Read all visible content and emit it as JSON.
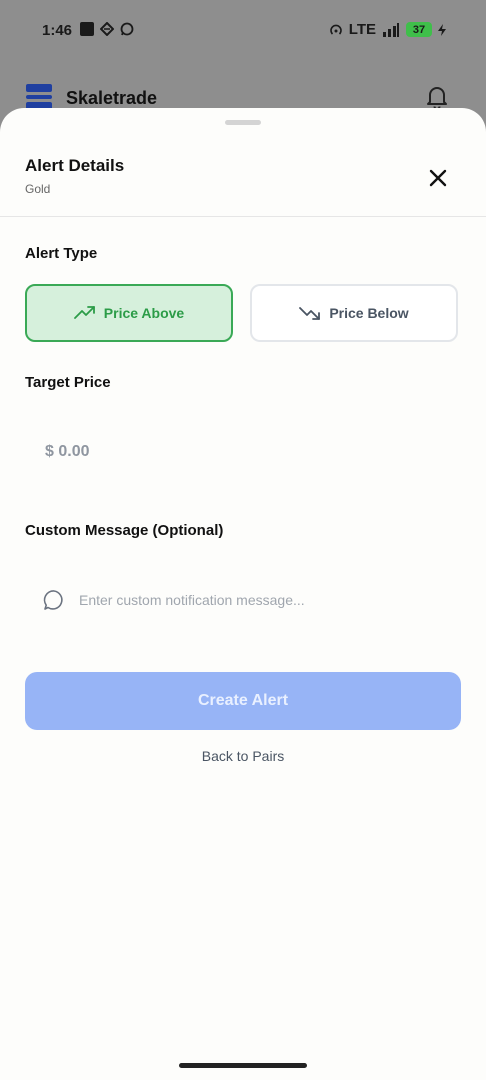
{
  "status_bar": {
    "time": "1:46",
    "network": "LTE",
    "battery": "37"
  },
  "app": {
    "brand": "Skaletrade",
    "brand_color": "#1f3fa0"
  },
  "sheet": {
    "title": "Alert Details",
    "subtitle": "Gold",
    "alert_type_label": "Alert Type",
    "price_above_label": "Price Above",
    "price_below_label": "Price Below",
    "selected_type": "price_above",
    "target_price_label": "Target Price",
    "target_price_placeholder": "$ 0.00",
    "custom_message_label": "Custom Message (Optional)",
    "custom_message_placeholder": "Enter custom notification message...",
    "create_button_label": "Create Alert",
    "back_link_label": "Back to Pairs"
  },
  "colors": {
    "accent_green": "#3aa956",
    "button_blue": "#97b4f6"
  },
  "icons": {
    "close": "close-icon",
    "trend_up": "trending-up-icon",
    "trend_down": "trending-down-icon",
    "message": "message-bubble-icon",
    "bell": "bell-icon"
  }
}
